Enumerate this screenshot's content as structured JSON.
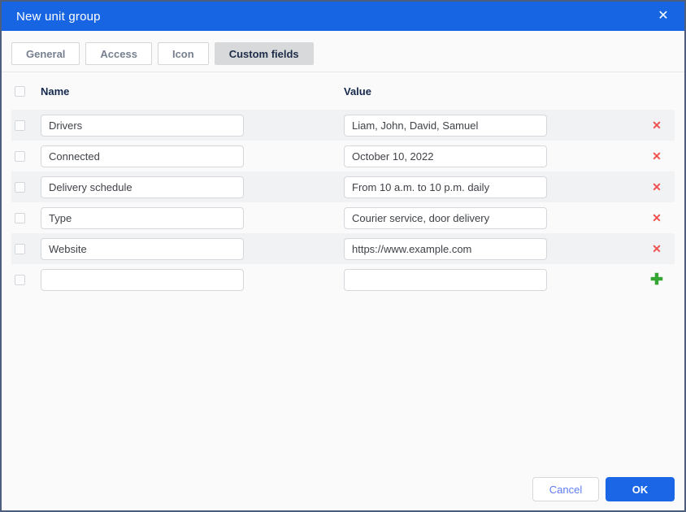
{
  "window": {
    "title": "New unit group",
    "close_icon": "✕"
  },
  "colors": {
    "titlebar_blue": "#1765e2",
    "window_border": "#4d5d7e",
    "active_tab_bg": "#d8d9da",
    "row_stripe": "#f1f2f4",
    "delete_red": "#ef4f4e",
    "add_green": "#35a532",
    "ok_blue": "#1b66e6",
    "cancel_text_blue": "#5f7cf8"
  },
  "tabs": [
    {
      "label": "General",
      "active": false
    },
    {
      "label": "Access",
      "active": false
    },
    {
      "label": "Icon",
      "active": false
    },
    {
      "label": "Custom fields",
      "active": true
    }
  ],
  "table": {
    "columns": {
      "name": "Name",
      "value": "Value"
    },
    "rows": [
      {
        "name": "Drivers",
        "value": "Liam, John, David, Samuel",
        "action": "delete"
      },
      {
        "name": "Connected",
        "value": "October 10, 2022",
        "action": "delete"
      },
      {
        "name": "Delivery schedule",
        "value": "From 10 a.m. to 10 p.m. daily",
        "action": "delete"
      },
      {
        "name": "Type",
        "value": "Courier service, door delivery",
        "action": "delete"
      },
      {
        "name": "Website",
        "value": "https://www.example.com",
        "action": "delete"
      },
      {
        "name": "",
        "value": "",
        "action": "add"
      }
    ]
  },
  "icons": {
    "delete": "✕",
    "add": "✚"
  },
  "footer": {
    "cancel_label": "Cancel",
    "ok_label": "OK"
  }
}
